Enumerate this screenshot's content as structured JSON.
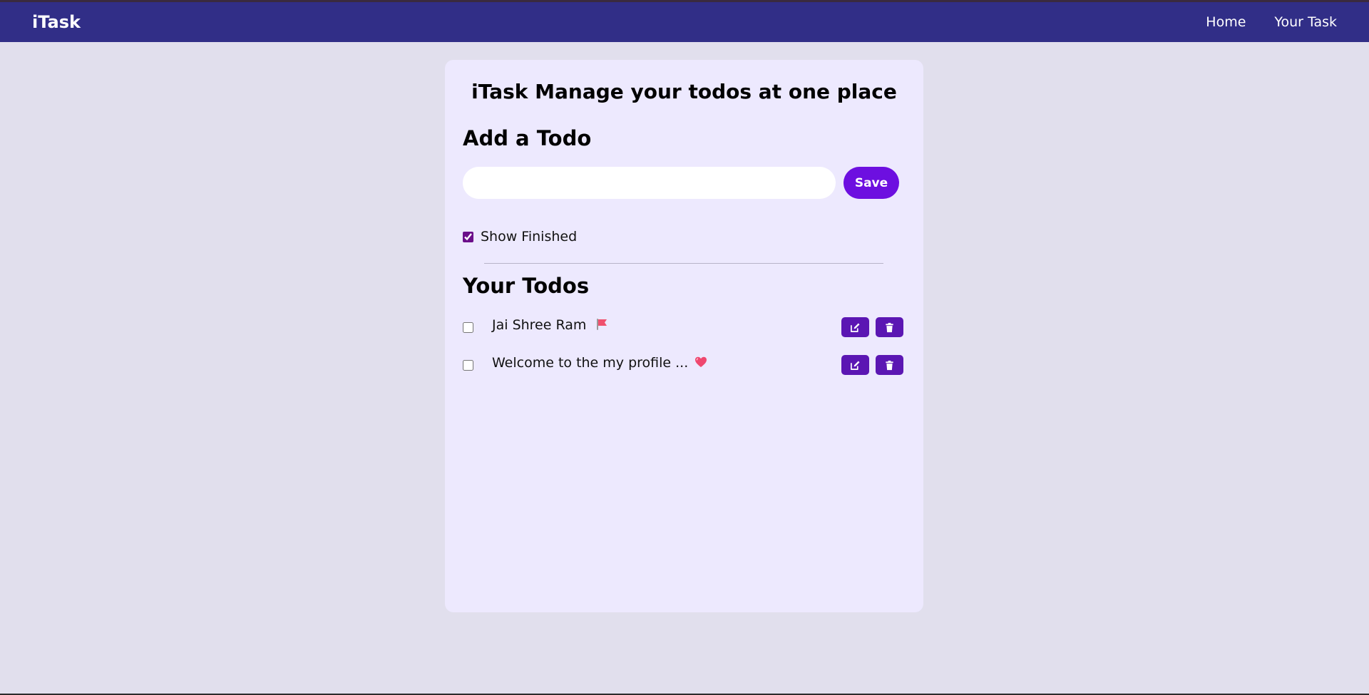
{
  "nav": {
    "brand": "iTask",
    "links": [
      "Home",
      "Your Task"
    ]
  },
  "main": {
    "title": "iTask Manage your todos at one place",
    "add_heading": "Add a Todo",
    "input_value": "",
    "save_label": "Save",
    "show_finished_label": "Show Finished",
    "show_finished_checked": true,
    "todos_heading": "Your Todos",
    "todos": [
      {
        "text": "Jai Shree Ram",
        "emoji": "flag-icon",
        "completed": false
      },
      {
        "text": "Welcome to the my profile ...",
        "emoji": "heart-icon",
        "completed": false
      }
    ]
  },
  "colors": {
    "navbar": "#312e87",
    "page_bg": "#e1dfed",
    "card_bg": "#ede9fe",
    "save_button": "#6d0fe0",
    "icon_button": "#5b16b3"
  }
}
